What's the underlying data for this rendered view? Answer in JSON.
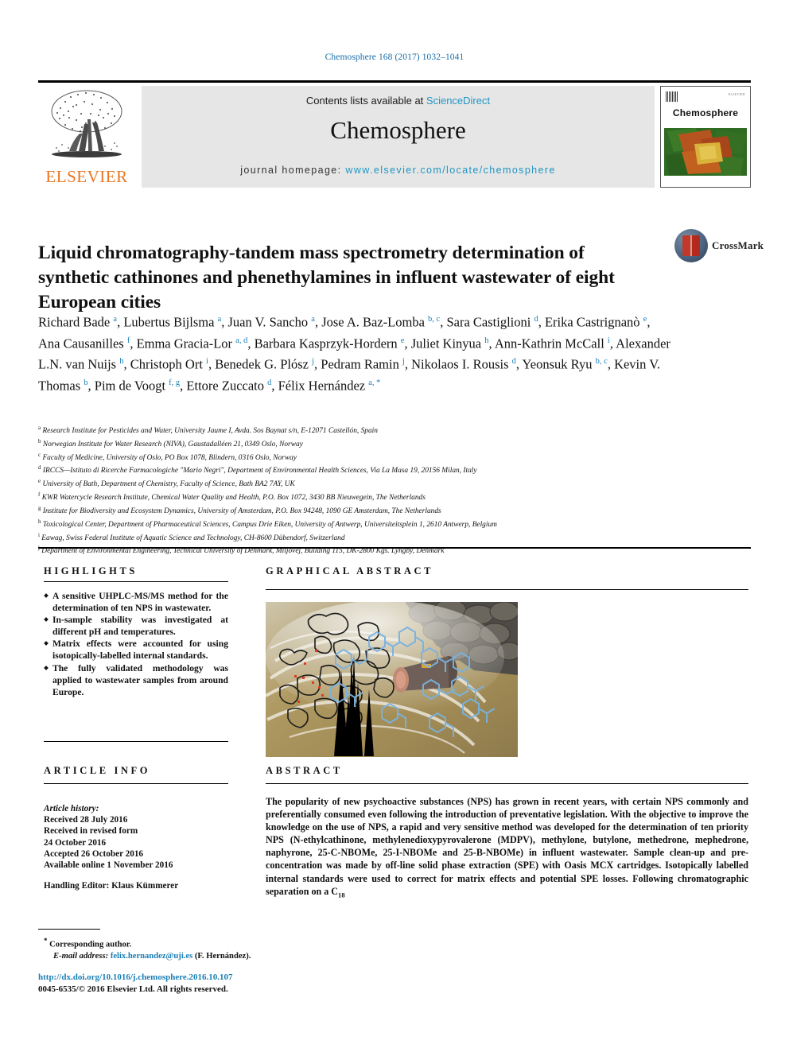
{
  "running_head": "Chemosphere 168 (2017) 1032–1041",
  "masthead": {
    "contents_prefix": "Contents lists available at ",
    "sciencedirect": "ScienceDirect",
    "journal_name": "Chemosphere",
    "homepage_prefix": "journal homepage: ",
    "homepage_url": "www.elsevier.com/locate/chemosphere",
    "publisher_logo_text": "ELSEVIER",
    "cover_title": "Chemosphere",
    "cover_publisher": "ELSEVIER",
    "link_color": "#2196c4",
    "elsevier_orange": "#E87722"
  },
  "crossmark": {
    "label": "CrossMark"
  },
  "title": "Liquid chromatography-tandem mass spectrometry determination of synthetic cathinones and phenethylamines in influent wastewater of eight European cities",
  "authors_html": "Richard Bade <sup>a</sup>, Lubertus Bijlsma <sup>a</sup>, Juan V. Sancho <sup>a</sup>, Jose A. Baz-Lomba <sup>b, c</sup>, Sara Castiglioni <sup>d</sup>, Erika Castrignanò <sup>e</sup>, Ana Causanilles <sup>f</sup>, Emma Gracia-Lor <sup>a, d</sup>, Barbara Kasprzyk-Hordern <sup>e</sup>, Juliet Kinyua <sup>h</sup>, Ann-Kathrin McCall <sup>i</sup>, Alexander L.N. van Nuijs <sup>h</sup>, Christoph Ort <sup>i</sup>, Benedek G. Plósz <sup>j</sup>, Pedram Ramin <sup>j</sup>, Nikolaos I. Rousis <sup>d</sup>, Yeonsuk Ryu <sup>b, c</sup>, Kevin V. Thomas <sup>b</sup>, Pim de Voogt <sup>f, g</sup>, Ettore Zuccato <sup>d</sup>, Félix Hernández <sup>a, *</sup>",
  "affiliations": [
    {
      "mark": "a",
      "text": "Research Institute for Pesticides and Water, University Jaume I, Avda. Sos Baynat s/n, E-12071 Castellón, Spain"
    },
    {
      "mark": "b",
      "text": "Norwegian Institute for Water Research (NIVA), Gaustadalléen 21, 0349 Oslo, Norway"
    },
    {
      "mark": "c",
      "text": "Faculty of Medicine, University of Oslo, PO Box 1078, Blindern, 0316 Oslo, Norway"
    },
    {
      "mark": "d",
      "text": "IRCCS—Istituto di Ricerche Farmacologiche \"Mario Negri\", Department of Environmental Health Sciences, Via La Masa 19, 20156 Milan, Italy"
    },
    {
      "mark": "e",
      "text": "University of Bath, Department of Chemistry, Faculty of Science, Bath BA2 7AY, UK"
    },
    {
      "mark": "f",
      "text": "KWR Watercycle Research Institute, Chemical Water Quality and Health, P.O. Box 1072, 3430 BB Nieuwegein, The Netherlands"
    },
    {
      "mark": "g",
      "text": "Institute for Biodiversity and Ecosystem Dynamics, University of Amsterdam, P.O. Box 94248, 1090 GE Amsterdam, The Netherlands"
    },
    {
      "mark": "h",
      "text": "Toxicological Center, Department of Pharmaceutical Sciences, Campus Drie Eiken, University of Antwerp, Universiteitsplein 1, 2610 Antwerp, Belgium"
    },
    {
      "mark": "i",
      "text": "Eawag, Swiss Federal Institute of Aquatic Science and Technology, CH-8600 Dübendorf, Switzerland"
    },
    {
      "mark": "j",
      "text": "Department of Environmental Engineering, Technical University of Denmark, Miljovej, Building 115, DK-2800 Kgs. Lyngby, Denmark"
    }
  ],
  "sections": {
    "highlights_heading": "HIGHLIGHTS",
    "graphical_abstract_heading": "GRAPHICAL ABSTRACT",
    "article_info_heading": "ARTICLE INFO",
    "abstract_heading": "ABSTRACT"
  },
  "highlights": [
    "A sensitive UHPLC-MS/MS method for the determination of ten NPS in wastewater.",
    "In-sample stability was investigated at different pH and temperatures.",
    "Matrix effects were accounted for using isotopically-labelled internal standards.",
    "The fully validated methodology was applied to wastewater samples from around Europe."
  ],
  "article_info": {
    "history_label": "Article history:",
    "received": "Received 28 July 2016",
    "revised_label": "Received in revised form",
    "revised_date": "24 October 2016",
    "accepted": "Accepted 26 October 2016",
    "available_online": "Available online 1 November 2016",
    "handling_editor": "Handling Editor: Klaus Kümmerer"
  },
  "abstract_html": "The popularity of new psychoactive substances (NPS) has grown in recent years, with certain NPS commonly and preferentially consumed even following the introduction of preventative legislation. With the objective to improve the knowledge on the use of NPS, a rapid and very sensitive method was developed for the determination of ten priority NPS (N-ethylcathinone, methylenedioxypyrovalerone (MDPV), methylone, butylone, methedrone, mephedrone, naphyrone, 25-C-NBOMe, 25-I-NBOMe and 25-B-NBOMe) in influent wastewater. Sample clean-up and pre-concentration was made by off-line solid phase extraction (SPE) with Oasis MCX cartridges. Isotopically labelled internal standards were used to correct for matrix effects and potential SPE losses. Following chromatographic separation on a C<sub>18</sub>",
  "footnote": {
    "star": "*",
    "corresponding": "Corresponding author.",
    "email_label": "E-mail address:",
    "email": "felix.hernandez@uji.es",
    "email_suffix": "(F. Hernández)."
  },
  "doi_block": {
    "doi_url": "http://dx.doi.org/10.1016/j.chemosphere.2016.10.107",
    "copyright": "0045-6535/© 2016 Elsevier Ltd. All rights reserved."
  },
  "graphical_abstract_image": {
    "description": "photo of foamy wastewater outfall pipe overlaid with Europe map, chromatogram peaks and blue chemical structures"
  }
}
